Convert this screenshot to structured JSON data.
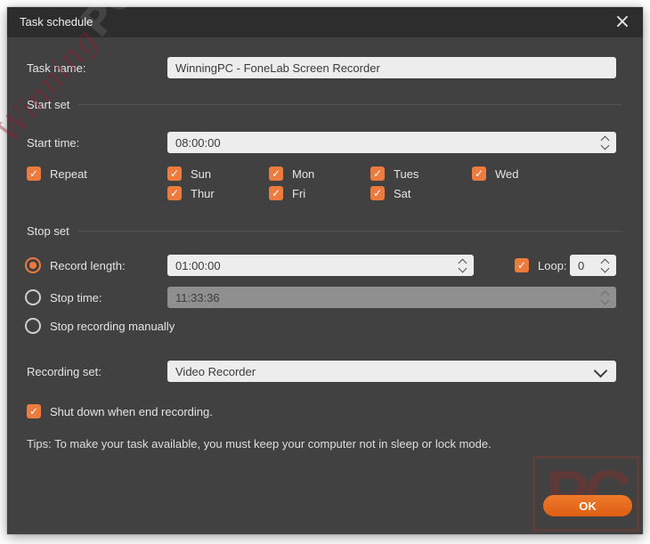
{
  "window": {
    "title": "Task schedule"
  },
  "icons": {
    "close": "×",
    "check": "✓"
  },
  "task_name": {
    "label": "Task name:",
    "value": "WinningPC - FoneLab Screen Recorder"
  },
  "sections": {
    "start": "Start set",
    "stop": "Stop set"
  },
  "start_time": {
    "label": "Start time:",
    "value": "08:00:00"
  },
  "repeat": {
    "label": "Repeat",
    "checked": true
  },
  "days": [
    {
      "label": "Sun",
      "checked": true
    },
    {
      "label": "Mon",
      "checked": true
    },
    {
      "label": "Tues",
      "checked": true
    },
    {
      "label": "Wed",
      "checked": true
    },
    {
      "label": "Thur",
      "checked": true
    },
    {
      "label": "Fri",
      "checked": true
    },
    {
      "label": "Sat",
      "checked": true
    }
  ],
  "record_length": {
    "label": "Record length:",
    "value": "01:00:00",
    "selected": true
  },
  "loop": {
    "label": "Loop:",
    "value": "0",
    "checked": true
  },
  "stop_time": {
    "label": "Stop time:",
    "value": "11:33:36",
    "selected": false,
    "disabled": true
  },
  "stop_manually": {
    "label": "Stop recording manually",
    "selected": false
  },
  "recording_set": {
    "label": "Recording set:",
    "value": "Video Recorder"
  },
  "shutdown": {
    "label": "Shut down when end recording.",
    "checked": true
  },
  "tips": "Tips: To make your task available, you must keep your computer not in sleep or lock mode.",
  "ok_button": {
    "label": "OK"
  },
  "watermarks": {
    "script_text": "Winning",
    "pc_text": "PC",
    "box_text": "PC"
  },
  "colors": {
    "accent": "#ee7b3e",
    "ok_button": "#e2661c",
    "titlebar": "#2d2d2d",
    "body": "#414141",
    "input_bg": "#ededed",
    "disabled_input_bg": "#8f8f8f"
  }
}
